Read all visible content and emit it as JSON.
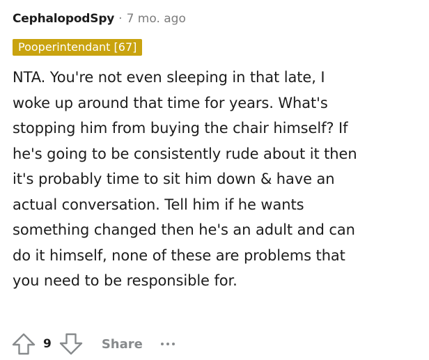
{
  "comment": {
    "author": "CephalopodSpy",
    "separator": "·",
    "timestamp": "7 mo. ago",
    "flair": "Pooperintendant [67]",
    "lines": [
      "NTA. You're not even sleeping in that late, I",
      "woke up around that time for years. What's",
      "stopping him from buying the chair himself? If",
      "he's going to be consistently rude about it then",
      "it's probably time to sit him down & have an",
      "actual conversation. Tell him if he wants",
      "something changed then he's an adult and can",
      "do it himself, none of these are problems that",
      "you need to be responsible for."
    ]
  },
  "actions": {
    "vote_count": "9",
    "share_label": "Share",
    "upvote_icon": "upvote-arrow-icon",
    "downvote_icon": "downvote-arrow-icon",
    "more_icon": "more-dots-icon"
  },
  "colors": {
    "flair_bg": "#c9a30f",
    "muted": "#7c7c7c",
    "icon": "#878a8c"
  }
}
